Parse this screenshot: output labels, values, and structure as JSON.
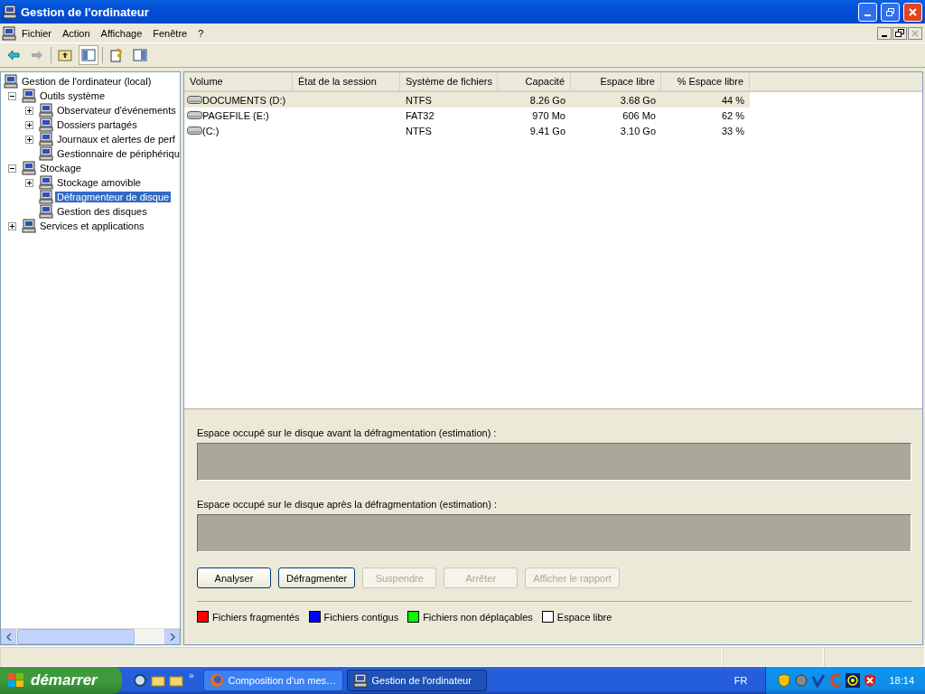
{
  "window": {
    "title": "Gestion de l'ordinateur"
  },
  "menu": [
    "Fichier",
    "Action",
    "Affichage",
    "Fenêtre",
    "?"
  ],
  "tree": [
    {
      "label": "Gestion de l'ordinateur (local)",
      "selected": false,
      "children": [
        {
          "label": "Outils système",
          "expanded": true,
          "selected": false,
          "children": [
            {
              "label": "Observateur d'événements",
              "expanded": false,
              "selected": false
            },
            {
              "label": "Dossiers partagés",
              "expanded": false,
              "selected": false
            },
            {
              "label": "Journaux et alertes de perf",
              "expanded": false,
              "selected": false
            },
            {
              "label": "Gestionnaire de périphériqu",
              "selected": false
            }
          ]
        },
        {
          "label": "Stockage",
          "expanded": true,
          "selected": false,
          "children": [
            {
              "label": "Stockage amovible",
              "expanded": false,
              "selected": false
            },
            {
              "label": "Défragmenteur de disque",
              "selected": true
            },
            {
              "label": "Gestion des disques",
              "selected": false
            }
          ]
        },
        {
          "label": "Services et applications",
          "expanded": false,
          "selected": false
        }
      ]
    }
  ],
  "table": {
    "columns": [
      "Volume",
      "État de la session",
      "Système de fichiers",
      "Capacité",
      "Espace libre",
      "% Espace libre"
    ],
    "rows": [
      {
        "selected": true,
        "cells": [
          "DOCUMENTS (D:)",
          "",
          "NTFS",
          "8.26 Go",
          "3.68 Go",
          "44 %"
        ]
      },
      {
        "selected": false,
        "cells": [
          "PAGEFILE (E:)",
          "",
          "FAT32",
          "970 Mo",
          "606 Mo",
          "62 %"
        ]
      },
      {
        "selected": false,
        "cells": [
          "(C:)",
          "",
          "NTFS",
          "9.41 Go",
          "3.10 Go",
          "33 %"
        ]
      }
    ]
  },
  "defrag": {
    "before_label": "Espace occupé sur le disque avant la défragmentation (estimation) :",
    "after_label": "Espace occupé sur le disque après la défragmentation (estimation) :",
    "buttons": [
      {
        "label": "Analyser",
        "disabled": false
      },
      {
        "label": "Défragmenter",
        "disabled": false
      },
      {
        "label": "Suspendre",
        "disabled": true
      },
      {
        "label": "Arrêter",
        "disabled": true
      },
      {
        "label": "Afficher le rapport",
        "disabled": true
      }
    ],
    "legend": [
      {
        "label": "Fichiers fragmentés",
        "color": "#ff0000"
      },
      {
        "label": "Fichiers contigus",
        "color": "#0000ff"
      },
      {
        "label": "Fichiers non déplaçables",
        "color": "#00ff00"
      },
      {
        "label": "Espace libre",
        "color": "#ffffff"
      }
    ]
  },
  "taskbar": {
    "start": "démarrer",
    "more": "»",
    "tasks": [
      {
        "label": "Composition d'un mes…",
        "selected": false
      },
      {
        "label": "Gestion de l'ordinateur",
        "selected": true
      }
    ],
    "language": "FR",
    "clock": "18:14"
  }
}
